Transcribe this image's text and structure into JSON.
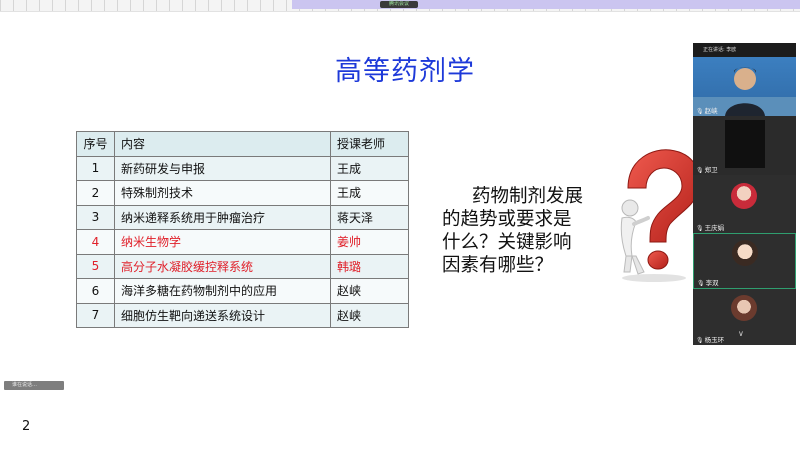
{
  "toolbar": {
    "meeting_label": "腾讯会议"
  },
  "slide": {
    "title": "高等药剂学",
    "page_number": "2",
    "question": {
      "line1": "药物制剂发展",
      "line2": "的趋势或要求是",
      "line3": "什么？关键影响",
      "line4": "因素有哪些？"
    }
  },
  "table": {
    "headers": {
      "no": "序号",
      "content": "内容",
      "teacher": "授课老师"
    },
    "rows": [
      {
        "no": "1",
        "content": "新药研发与申报",
        "teacher": "王成"
      },
      {
        "no": "2",
        "content": "特殊制剂技术",
        "teacher": "王成"
      },
      {
        "no": "3",
        "content": "纳米递释系统用于肿瘤治疗",
        "teacher": "蒋天泽"
      },
      {
        "no": "4",
        "content": "纳米生物学",
        "teacher": "姜帅"
      },
      {
        "no": "5",
        "content": "高分子水凝胶缓控释系统",
        "teacher": "韩璐"
      },
      {
        "no": "6",
        "content": "海洋多糖在药物制剂中的应用",
        "teacher": "赵峡"
      },
      {
        "no": "7",
        "content": "细胞仿生靶向递送系统设计",
        "teacher": "赵峡"
      }
    ]
  },
  "video_panel": {
    "speaking_header": "正在讲话: 李欧",
    "participants": [
      {
        "name": "赵峡"
      },
      {
        "name": "郑卫"
      },
      {
        "name": "王庆娟"
      },
      {
        "name": "李双"
      },
      {
        "name": "杨玉环"
      }
    ]
  },
  "status_pill": "谁在说话…",
  "colors": {
    "title_blue": "#1d39d9",
    "highlight_red": "#e0202a",
    "table_header": "#dcecef",
    "question_red": "#d62a26"
  }
}
